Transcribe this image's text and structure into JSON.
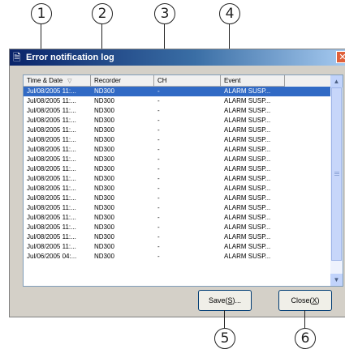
{
  "window": {
    "title": "Error notification log",
    "title_icon": "log-window-icon",
    "close_label": "✕"
  },
  "callouts": [
    "1",
    "2",
    "3",
    "4",
    "5",
    "6"
  ],
  "columns": [
    {
      "label": "Time & Date",
      "sort": "descending"
    },
    {
      "label": "Recorder"
    },
    {
      "label": "CH"
    },
    {
      "label": "Event"
    }
  ],
  "rows": [
    {
      "time": "Jul/08/2005 11:...",
      "recorder": "ND300",
      "ch": "-",
      "event": "ALARM SUSP...",
      "selected": true
    },
    {
      "time": "Jul/08/2005 11:...",
      "recorder": "ND300",
      "ch": "-",
      "event": "ALARM SUSP..."
    },
    {
      "time": "Jul/08/2005 11:...",
      "recorder": "ND300",
      "ch": "-",
      "event": "ALARM SUSP..."
    },
    {
      "time": "Jul/08/2005 11:...",
      "recorder": "ND300",
      "ch": "-",
      "event": "ALARM SUSP..."
    },
    {
      "time": "Jul/08/2005 11:...",
      "recorder": "ND300",
      "ch": "-",
      "event": "ALARM SUSP..."
    },
    {
      "time": "Jul/08/2005 11:...",
      "recorder": "ND300",
      "ch": "-",
      "event": "ALARM SUSP..."
    },
    {
      "time": "Jul/08/2005 11:...",
      "recorder": "ND300",
      "ch": "-",
      "event": "ALARM SUSP..."
    },
    {
      "time": "Jul/08/2005 11:...",
      "recorder": "ND300",
      "ch": "-",
      "event": "ALARM SUSP..."
    },
    {
      "time": "Jul/08/2005 11:...",
      "recorder": "ND300",
      "ch": "-",
      "event": "ALARM SUSP..."
    },
    {
      "time": "Jul/08/2005 11:...",
      "recorder": "ND300",
      "ch": "-",
      "event": "ALARM SUSP..."
    },
    {
      "time": "Jul/08/2005 11:...",
      "recorder": "ND300",
      "ch": "-",
      "event": "ALARM SUSP..."
    },
    {
      "time": "Jul/08/2005 11:...",
      "recorder": "ND300",
      "ch": "-",
      "event": "ALARM SUSP..."
    },
    {
      "time": "Jul/08/2005 11:...",
      "recorder": "ND300",
      "ch": "-",
      "event": "ALARM SUSP..."
    },
    {
      "time": "Jul/08/2005 11:...",
      "recorder": "ND300",
      "ch": "-",
      "event": "ALARM SUSP..."
    },
    {
      "time": "Jul/08/2005 11:...",
      "recorder": "ND300",
      "ch": "-",
      "event": "ALARM SUSP..."
    },
    {
      "time": "Jul/08/2005 11:...",
      "recorder": "ND300",
      "ch": "-",
      "event": "ALARM SUSP..."
    },
    {
      "time": "Jul/08/2005 11:...",
      "recorder": "ND300",
      "ch": "-",
      "event": "ALARM SUSP..."
    },
    {
      "time": "Jul/06/2005 04:...",
      "recorder": "ND300",
      "ch": "-",
      "event": "ALARM SUSP..."
    }
  ],
  "buttons": {
    "save": {
      "label": "Save",
      "mnemonic": "S",
      "suffix": "..."
    },
    "close": {
      "label": "Close",
      "mnemonic": "X"
    }
  },
  "colors": {
    "titlebar_start": "#0a246a",
    "selection": "#316ac5",
    "dialog_bg": "#d4d0c8"
  }
}
